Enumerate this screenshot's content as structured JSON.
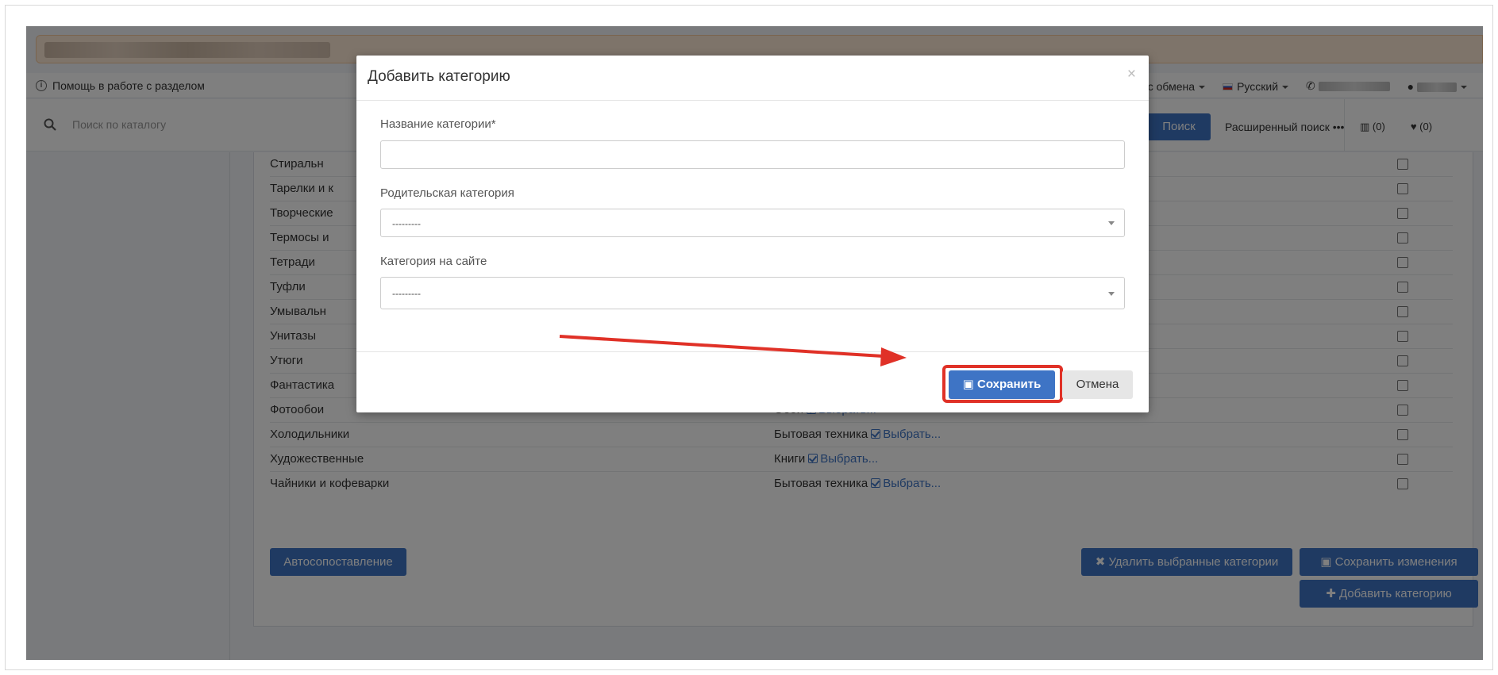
{
  "header": {
    "help_label": "Помощь в работе с разделом",
    "currency_label": "Курс обмена",
    "language_label": "Русский"
  },
  "search": {
    "placeholder": "Поиск по каталогу",
    "button_label": "Поиск",
    "advanced_label": "Расширенный поиск",
    "compare_count": "(0)",
    "favorites_count": "(0)"
  },
  "table": {
    "rows": [
      {
        "name": "Стиральн",
        "parent": "",
        "pick": ""
      },
      {
        "name": "Тарелки и к",
        "parent": "",
        "pick": ""
      },
      {
        "name": "Творческие",
        "parent": "",
        "pick": ""
      },
      {
        "name": "Термосы и",
        "parent": "",
        "pick": ""
      },
      {
        "name": "Тетради",
        "parent": "",
        "pick": ""
      },
      {
        "name": "Туфли",
        "parent": "",
        "pick": ""
      },
      {
        "name": "Умывальн",
        "parent": "",
        "pick": ""
      },
      {
        "name": "Унитазы",
        "parent": "",
        "pick": ""
      },
      {
        "name": "Утюги",
        "parent": "",
        "pick": ""
      },
      {
        "name": "Фантастика",
        "parent": "",
        "pick": ""
      },
      {
        "name": "Фотообои",
        "parent": "Обои",
        "pick": "Выбрать..."
      },
      {
        "name": "Холодильники",
        "parent": "Бытовая техника",
        "pick": "Выбрать..."
      },
      {
        "name": "Художественные",
        "parent": "Книги",
        "pick": "Выбрать..."
      },
      {
        "name": "Чайники и кофеварки",
        "parent": "Бытовая техника",
        "pick": "Выбрать..."
      }
    ]
  },
  "actions": {
    "auto_match": "Автосопоставление",
    "delete_selected": "Удалить выбранные категории",
    "save_changes": "Сохранить изменения",
    "add_category": "Добавить категорию"
  },
  "modal": {
    "title": "Добавить категорию",
    "close": "×",
    "name_label": "Название категории*",
    "name_value": "",
    "parent_label": "Родительская категория",
    "parent_value": "---------",
    "site_label": "Категория на сайте",
    "site_value": "---------",
    "save_label": "Сохранить",
    "cancel_label": "Отмена"
  },
  "colors": {
    "primary": "#3e74c5",
    "highlight": "#e03127"
  }
}
